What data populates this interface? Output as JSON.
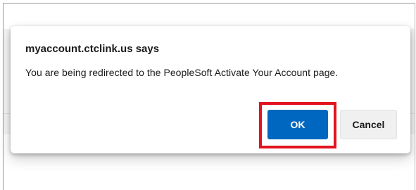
{
  "dialog": {
    "title": "myaccount.ctclink.us says",
    "message": "You are being redirected to the PeopleSoft Activate Your Account page.",
    "buttons": {
      "ok_label": "OK",
      "cancel_label": "Cancel"
    }
  },
  "colors": {
    "ok_button": "#0067c0",
    "highlight": "#e2131f",
    "cancel_button": "#f0f0f0"
  }
}
